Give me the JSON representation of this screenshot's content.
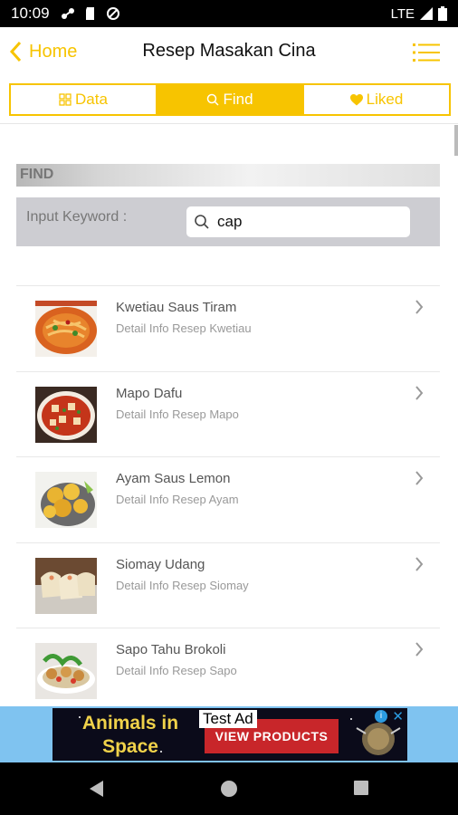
{
  "status_bar": {
    "time": "10:09",
    "network": "LTE"
  },
  "nav": {
    "back_label": "Home",
    "title": "Resep Masakan Cina"
  },
  "tabs": [
    {
      "label": "Data",
      "icon": "grid-icon",
      "active": false
    },
    {
      "label": "Find",
      "icon": "search-icon",
      "active": true
    },
    {
      "label": "Liked",
      "icon": "heart-icon",
      "active": false
    }
  ],
  "find": {
    "header": "FIND",
    "label": "Input Keyword :",
    "value": "cap"
  },
  "results": [
    {
      "title": "Kwetiau Saus Tiram",
      "subtitle": "Detail Info Resep Kwetiau"
    },
    {
      "title": "Mapo Dafu",
      "subtitle": "Detail Info Resep Mapo"
    },
    {
      "title": "Ayam Saus Lemon",
      "subtitle": "Detail Info Resep Ayam"
    },
    {
      "title": "Siomay Udang",
      "subtitle": "Detail Info Resep Siomay"
    },
    {
      "title": "Sapo Tahu Brokoli",
      "subtitle": "Detail Info Resep Sapo"
    }
  ],
  "ad": {
    "headline": "Animals in Space",
    "tag": "Test Ad",
    "cta": "VIEW PRODUCTS"
  },
  "colors": {
    "accent": "#f7c400",
    "ad_background": "#7fc3f0",
    "ad_cta": "#c8262a"
  }
}
